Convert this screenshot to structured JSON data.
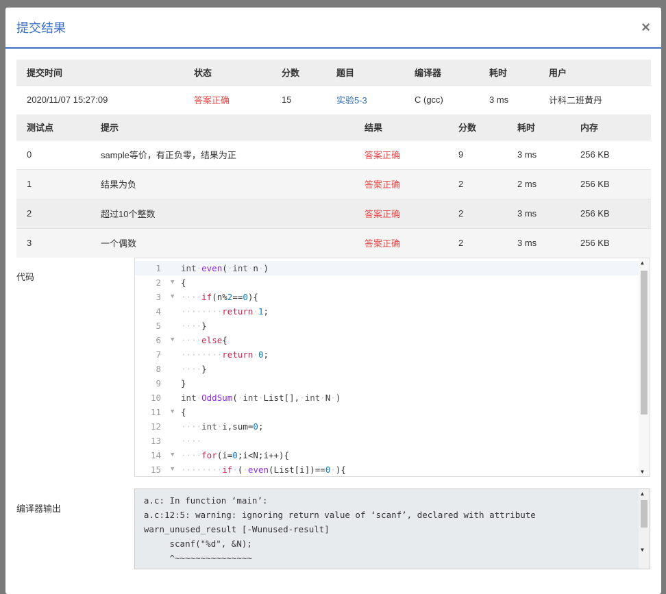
{
  "modal": {
    "title": "提交结果",
    "close_glyph": "×"
  },
  "summary": {
    "headers": [
      "提交时间",
      "状态",
      "分数",
      "题目",
      "编译器",
      "耗时",
      "用户"
    ],
    "row": {
      "time": "2020/11/07 15:27:09",
      "status": "答案正确",
      "score": "15",
      "problem": "实验5-3",
      "compiler": "C (gcc)",
      "elapsed": "3 ms",
      "user": "计科二班黄丹"
    }
  },
  "tests": {
    "headers": [
      "测试点",
      "提示",
      "结果",
      "分数",
      "耗时",
      "内存"
    ],
    "rows": [
      {
        "id": "0",
        "hint": "sample等价，有正负零，结果为正",
        "result": "答案正确",
        "score": "9",
        "time": "3 ms",
        "mem": "256 KB"
      },
      {
        "id": "1",
        "hint": "结果为负",
        "result": "答案正确",
        "score": "2",
        "time": "2 ms",
        "mem": "256 KB"
      },
      {
        "id": "2",
        "hint": "超过10个整数",
        "result": "答案正确",
        "score": "2",
        "time": "3 ms",
        "mem": "256 KB"
      },
      {
        "id": "3",
        "hint": "一个偶数",
        "result": "答案正确",
        "score": "2",
        "time": "3 ms",
        "mem": "256 KB"
      }
    ]
  },
  "code": {
    "label": "代码",
    "lines": [
      {
        "n": "1",
        "fold": "",
        "text": "int·even(·int·n·)"
      },
      {
        "n": "2",
        "fold": "▼",
        "text": "{"
      },
      {
        "n": "3",
        "fold": "▼",
        "text": "····if(n%2==0){"
      },
      {
        "n": "4",
        "fold": "",
        "text": "········return·1;"
      },
      {
        "n": "5",
        "fold": "",
        "text": "····}"
      },
      {
        "n": "6",
        "fold": "▼",
        "text": "····else{"
      },
      {
        "n": "7",
        "fold": "",
        "text": "········return·0;"
      },
      {
        "n": "8",
        "fold": "",
        "text": "····}"
      },
      {
        "n": "9",
        "fold": "",
        "text": "}"
      },
      {
        "n": "10",
        "fold": "",
        "text": "int·OddSum(·int·List[],·int·N·)"
      },
      {
        "n": "11",
        "fold": "▼",
        "text": "{"
      },
      {
        "n": "12",
        "fold": "",
        "text": "····int·i,sum=0;"
      },
      {
        "n": "13",
        "fold": "",
        "text": "····"
      },
      {
        "n": "14",
        "fold": "▼",
        "text": "····for(i=0;i<N;i++){"
      },
      {
        "n": "15",
        "fold": "▼",
        "text": "········if·(·even(List[i])==0·){"
      }
    ]
  },
  "compiler_output": {
    "label": "编译器输出",
    "lines": [
      "a.c: In function ‘main’:",
      "a.c:12:5: warning: ignoring return value of ‘scanf’, declared with attribute",
      "warn_unused_result [-Wunused-result]",
      "     scanf(\"%d\", &N);",
      "     ^~~~~~~~~~~~~~~~"
    ]
  },
  "colors": {
    "accent": "#3a6fc4",
    "status_ok": "#e64a4a",
    "link": "#2c6cb5"
  }
}
